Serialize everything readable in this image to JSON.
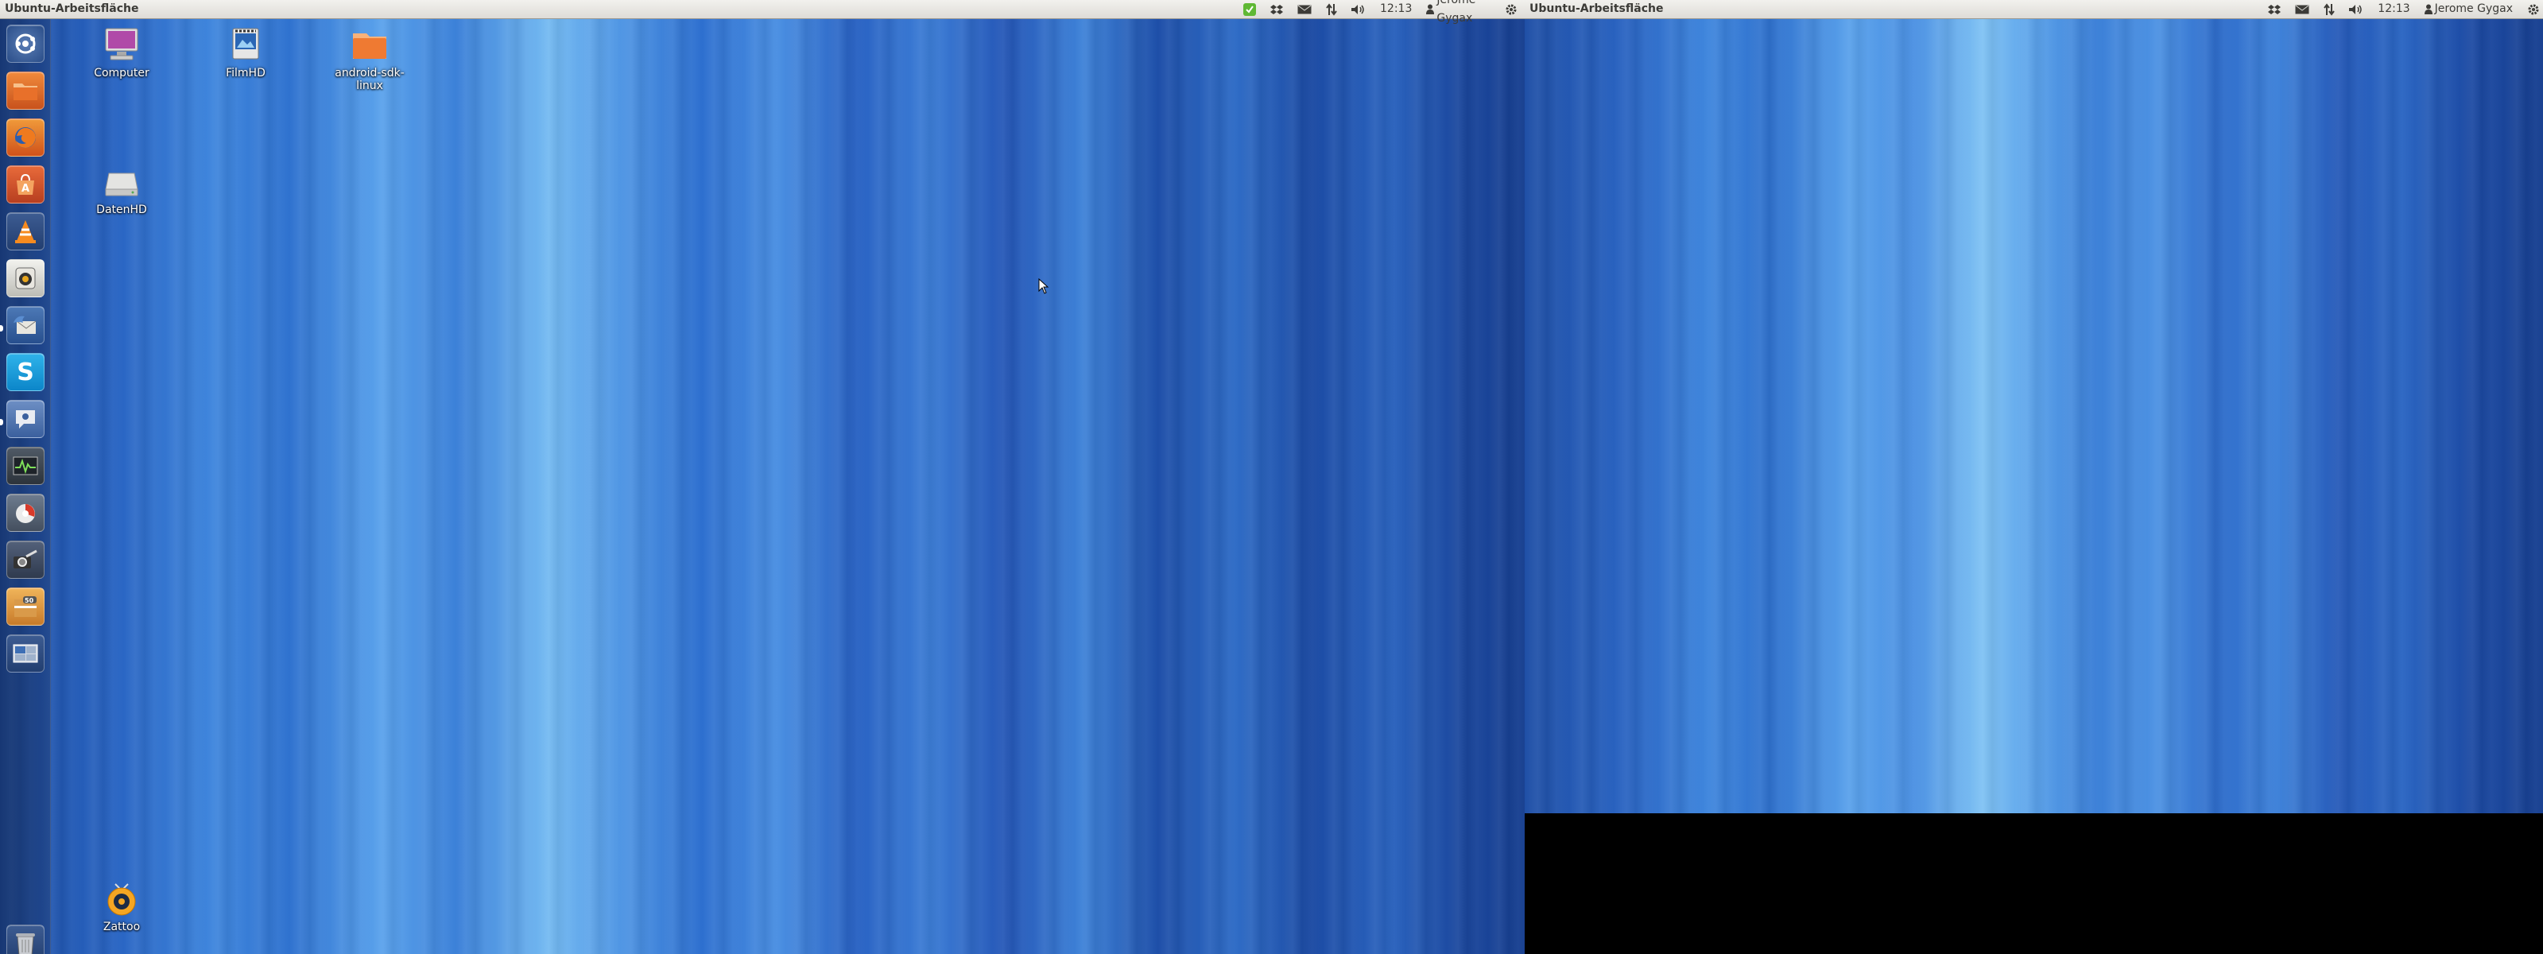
{
  "left_screen": {
    "panel": {
      "title": "Ubuntu-Arbeitsfläche",
      "clock": "12:13",
      "user": "Jerome Gygax",
      "indicators": [
        "update-check-icon",
        "dropbox-icon",
        "mail-icon",
        "network-icon",
        "volume-icon",
        "clock",
        "user-icon",
        "session-gear-icon"
      ]
    },
    "launcher": {
      "items": [
        "dash-home-icon",
        "files-icon",
        "firefox-icon",
        "software-center-icon",
        "vlc-icon",
        "rhythmbox-icon",
        "thunderbird-icon",
        "skype-icon",
        "empathy-icon",
        "system-monitor-icon",
        "disk-usage-icon",
        "image-viewer-icon",
        "archive-manager-icon",
        "workspace-switcher-icon",
        "trash-icon"
      ],
      "badge": "50"
    },
    "desktop_icons": [
      {
        "name": "computer-icon",
        "label": "Computer"
      },
      {
        "name": "film-folder-icon",
        "label": "FilmHD"
      },
      {
        "name": "folder-icon",
        "label": "android-sdk-linux"
      },
      {
        "name": "drive-icon",
        "label": "DatenHD"
      },
      {
        "name": "zattoo-icon",
        "label": "Zattoo"
      }
    ]
  },
  "right_screen": {
    "panel": {
      "title": "Ubuntu-Arbeitsfläche",
      "clock": "12:13",
      "user": "Jerome Gygax"
    }
  }
}
